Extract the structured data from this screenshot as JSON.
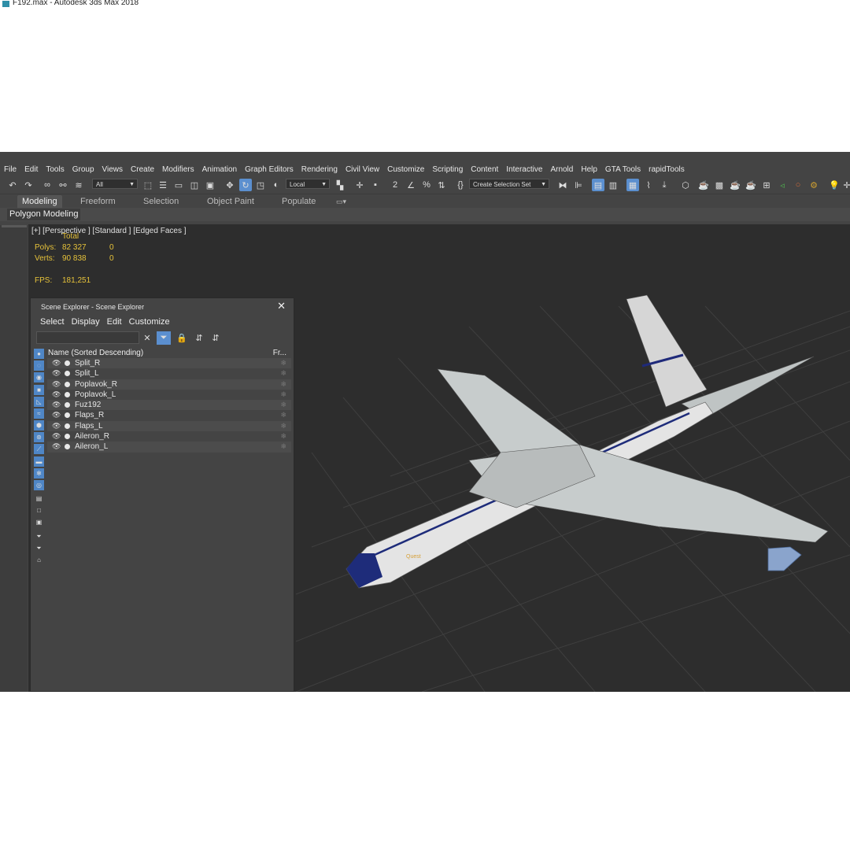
{
  "window": {
    "title": "F192.max - Autodesk 3ds Max 2018"
  },
  "menu": [
    "File",
    "Edit",
    "Tools",
    "Group",
    "Views",
    "Create",
    "Modifiers",
    "Animation",
    "Graph Editors",
    "Rendering",
    "Civil View",
    "Customize",
    "Scripting",
    "Content",
    "Interactive",
    "Arnold",
    "Help",
    "GTA Tools",
    "rapidTools"
  ],
  "toolbar": {
    "selection_filter": "All",
    "ref_coord": "Local",
    "selection_set": "Create Selection Set"
  },
  "ribbon": {
    "tabs": [
      "Modeling",
      "Freeform",
      "Selection",
      "Object Paint",
      "Populate"
    ],
    "active_tab": "Modeling",
    "panel_label": "Polygon Modeling"
  },
  "viewport": {
    "label": "[+] [Perspective ] [Standard ] [Edged Faces ]",
    "stats": {
      "total_label": "Total",
      "polys_label": "Polys:",
      "polys_total": "82 327",
      "polys_sel": "0",
      "verts_label": "Verts:",
      "verts_total": "90 838",
      "verts_sel": "0",
      "fps_label": "FPS:",
      "fps_value": "181,251"
    },
    "model_label": "Quest"
  },
  "scene_explorer": {
    "title": "Scene Explorer - Scene Explorer",
    "menu": [
      "Select",
      "Display",
      "Edit",
      "Customize"
    ],
    "column_name": "Name (Sorted Descending)",
    "column_frozen": "Fr...",
    "objects": [
      "Split_R",
      "Split_L",
      "Poplavok_R",
      "Poplavok_L",
      "Fuz192",
      "Flaps_R",
      "Flaps_L",
      "Aileron_R",
      "Aileron_L"
    ]
  },
  "colors": {
    "accent": "#5b8fcf",
    "stats_text": "#e6c23a",
    "viewport_bg": "#2d2d2d"
  }
}
